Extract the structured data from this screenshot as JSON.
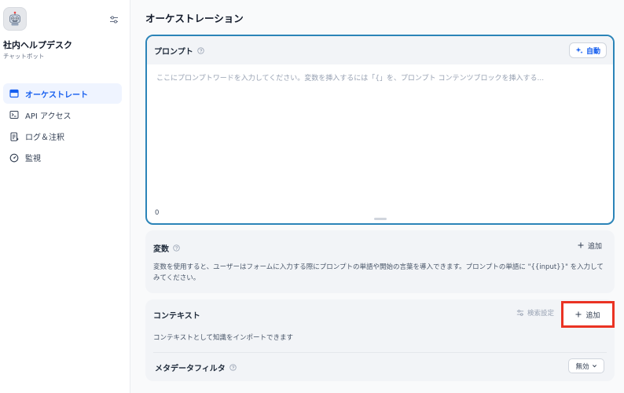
{
  "app": {
    "name": "社内ヘルプデスク",
    "type": "チャットボット",
    "avatar_icon": "robot-icon"
  },
  "sidebar": {
    "items": [
      {
        "label": "オーケストレート",
        "icon": "layout-icon",
        "active": true
      },
      {
        "label": "API アクセス",
        "icon": "terminal-icon",
        "active": false
      },
      {
        "label": "ログ＆注釈",
        "icon": "log-icon",
        "active": false
      },
      {
        "label": "監視",
        "icon": "gauge-icon",
        "active": false
      }
    ]
  },
  "main": {
    "title": "オーケストレーション",
    "prompt": {
      "title": "プロンプト",
      "auto_label": "自動",
      "placeholder": "ここにプロンプトワードを入力してください。変数を挿入するには「{」を、プロンプト コンテンツブロックを挿入する...",
      "char_count": "0"
    },
    "variables": {
      "title": "変数",
      "add_label": "追加",
      "description": "変数を使用すると、ユーザーはフォームに入力する際にプロンプトの単語や開始の言葉を導入できます。プロンプトの単語に \"{{input}}\" を入力してみてください。"
    },
    "context": {
      "title": "コンテキスト",
      "search_settings_label": "検索設定",
      "add_label": "追加",
      "description": "コンテキストとして知識をインポートできます",
      "metadata_filter": {
        "title": "メタデータフィルタ",
        "value": "無効"
      }
    }
  },
  "colors": {
    "accent": "#155eef",
    "prompt_border": "#2b84b8",
    "highlight": "#ea3323"
  }
}
